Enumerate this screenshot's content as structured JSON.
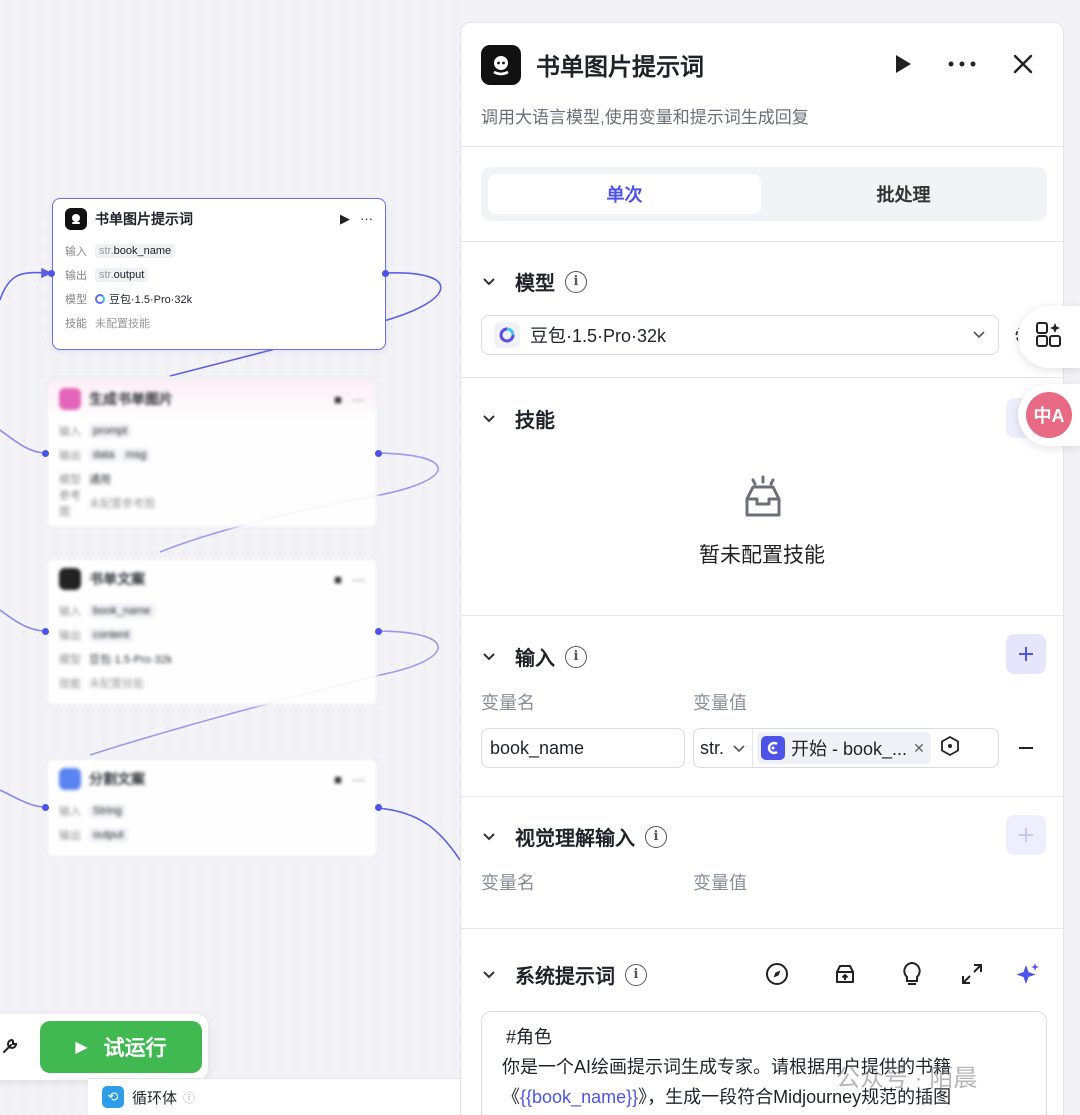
{
  "canvas": {
    "active_node": {
      "title": "书单图片提示词",
      "rows": [
        {
          "key": "输入",
          "type": "str.",
          "value": "book_name"
        },
        {
          "key": "输出",
          "type": "str.",
          "value": "output"
        },
        {
          "key": "模型",
          "value": "豆包·1.5·Pro·32k"
        },
        {
          "key": "技能",
          "value": "未配置技能"
        }
      ]
    },
    "node2": {
      "title": "生成书单图片",
      "r1": "prompt",
      "r2a": "data",
      "r2b": "msg",
      "r3": "通用",
      "r4": "未配置参考图"
    },
    "node3": {
      "title": "书单文案",
      "r1": "book_name",
      "r2": "content",
      "r3": "豆包·1.5·Pro·32k",
      "r4": "未配置技能"
    },
    "node4": {
      "title": "分割文案",
      "r1": "String",
      "r2": "output"
    },
    "toolbar": {
      "run_label": "试运行"
    },
    "loop_label": "循环体"
  },
  "panel": {
    "title": "书单图片提示词",
    "description": "调用大语言模型,使用变量和提示词生成回复",
    "tabs": [
      {
        "label": "单次"
      },
      {
        "label": "批处理"
      }
    ],
    "model": {
      "section": "模型",
      "selected": "豆包·1.5·Pro·32k"
    },
    "skills": {
      "section": "技能",
      "empty": "暂未配置技能"
    },
    "input": {
      "section": "输入",
      "col_name": "变量名",
      "col_value": "变量值",
      "row": {
        "name": "book_name",
        "type": "str.",
        "ref": "开始 - book_..."
      }
    },
    "vision": {
      "section": "视觉理解输入",
      "col_name": "变量名",
      "col_value": "变量值"
    },
    "system_prompt": {
      "section": "系统提示词",
      "line1": "#角色",
      "line2": "你是一个AI绘画提示词生成专家。请根据用户提供的书籍",
      "line3_pre": "《",
      "line3_var": "{{book_name}}",
      "line3_post": "》，生成一段符合Midjourney规范的插图"
    }
  },
  "overlay": {
    "translate_glyph": "中A",
    "watermark": "公众号 · 陌晨"
  },
  "colors": {
    "accent": "#4d53e8",
    "run_green": "#3fb950",
    "translate_pink": "#e86a84"
  },
  "icons": [
    "play-icon",
    "more-icon",
    "close-icon",
    "chevron-down-icon",
    "info-icon",
    "plus-icon",
    "minus-icon",
    "tray-icon",
    "compass-icon",
    "library-icon",
    "bulb-icon",
    "expand-icon",
    "sparkle-icon",
    "settings-icon",
    "wrench-icon",
    "loop-icon",
    "translate-icon",
    "apps-icon"
  ]
}
